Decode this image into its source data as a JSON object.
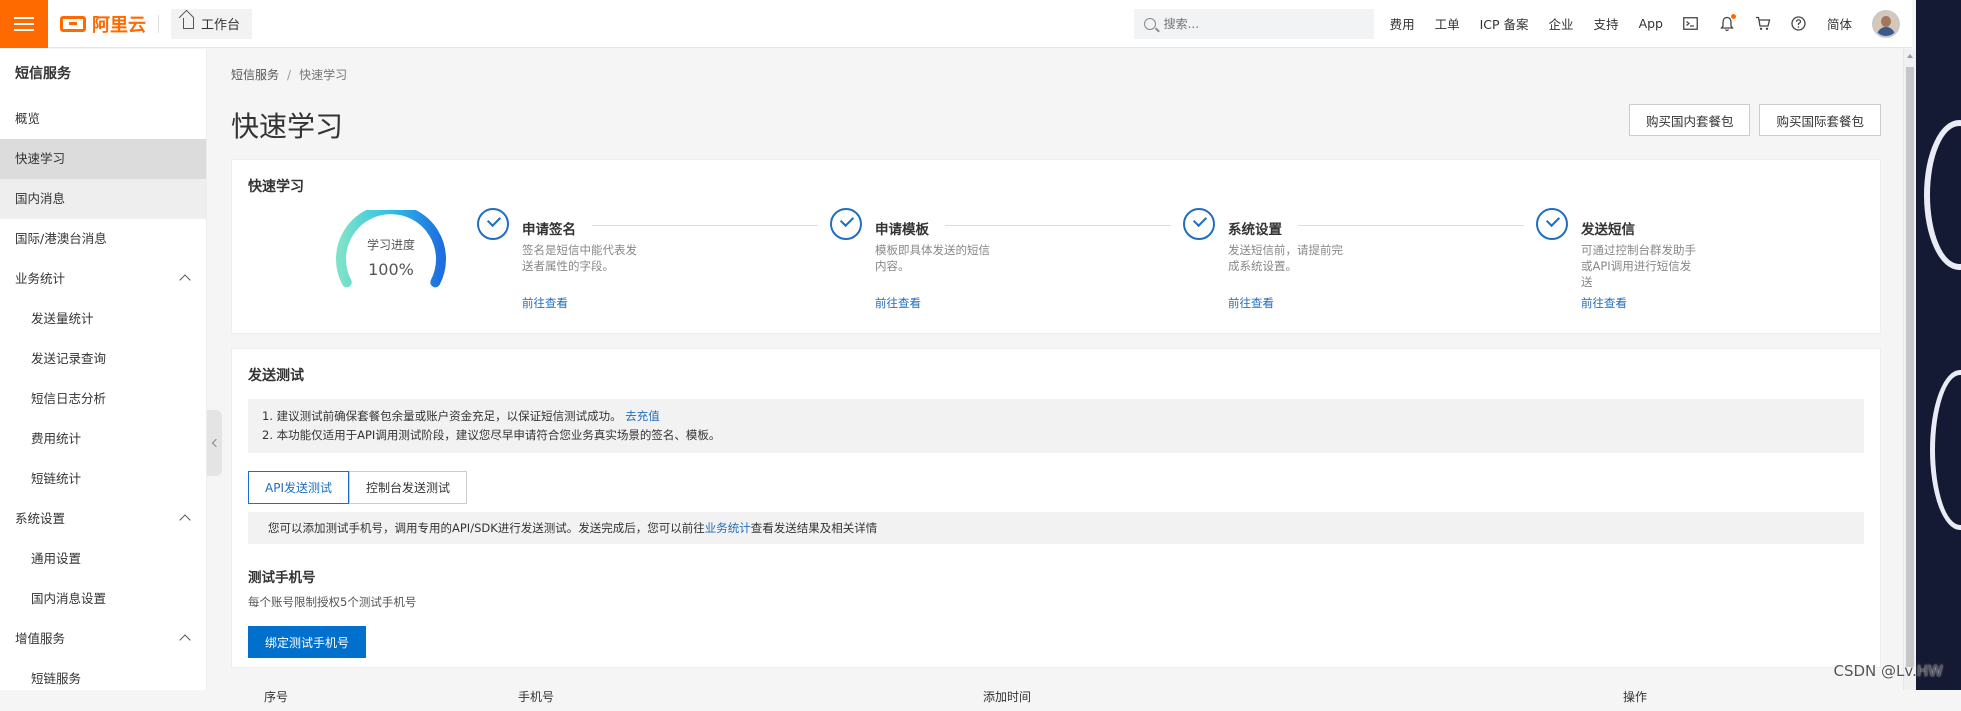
{
  "topbar": {
    "logo_text": "阿里云",
    "workbench_label": "工作台",
    "search_placeholder": "搜索...",
    "nav": [
      "费用",
      "工单",
      "ICP 备案",
      "企业",
      "支持",
      "App"
    ],
    "lang": "简体",
    "icons": [
      "terminal-icon",
      "bell-icon",
      "cart-icon",
      "help-icon"
    ],
    "accent_color": "#ff6a00"
  },
  "sidebar": {
    "title": "短信服务",
    "items": [
      {
        "label": "概览",
        "level": 0,
        "state": ""
      },
      {
        "label": "快速学习",
        "level": 0,
        "state": "active"
      },
      {
        "label": "国内消息",
        "level": 0,
        "state": "grey"
      },
      {
        "label": "国际/港澳台消息",
        "level": 0,
        "state": ""
      },
      {
        "label": "业务统计",
        "level": 0,
        "state": "",
        "expanded": true
      },
      {
        "label": "发送量统计",
        "level": 1,
        "state": ""
      },
      {
        "label": "发送记录查询",
        "level": 1,
        "state": ""
      },
      {
        "label": "短信日志分析",
        "level": 1,
        "state": ""
      },
      {
        "label": "费用统计",
        "level": 1,
        "state": ""
      },
      {
        "label": "短链统计",
        "level": 1,
        "state": ""
      },
      {
        "label": "系统设置",
        "level": 0,
        "state": "",
        "expanded": true
      },
      {
        "label": "通用设置",
        "level": 1,
        "state": ""
      },
      {
        "label": "国内消息设置",
        "level": 1,
        "state": ""
      },
      {
        "label": "增值服务",
        "level": 0,
        "state": "",
        "expanded": true
      },
      {
        "label": "短链服务",
        "level": 1,
        "state": ""
      }
    ]
  },
  "breadcrumb": {
    "root": "短信服务",
    "sep": "/",
    "current": "快速学习"
  },
  "page": {
    "title": "快速学习",
    "buy_domestic": "购买国内套餐包",
    "buy_international": "购买国际套餐包"
  },
  "quick": {
    "title": "快速学习",
    "progress_label": "学习进度",
    "progress_text": "100%",
    "progress_value": 1.0,
    "steps": [
      {
        "title": "申请签名",
        "desc": "签名是短信中能代表发送者属性的字段。",
        "link": "前往查看"
      },
      {
        "title": "申请模板",
        "desc": "模板即具体发送的短信内容。",
        "link": "前往查看"
      },
      {
        "title": "系统设置",
        "desc": "发送短信前，请提前完成系统设置。",
        "link": "前往查看"
      },
      {
        "title": "发送短信",
        "desc": "可通过控制台群发助手或API调用进行短信发送",
        "link": "前往查看"
      }
    ]
  },
  "test": {
    "title": "发送测试",
    "notice_1": "1. 建议测试前确保套餐包余量或账户资金充足，以保证短信测试成功。",
    "notice_1_link": "去充值",
    "notice_2": "2. 本功能仅适用于API调用测试阶段，建议您尽早申请符合您业务真实场景的签名、模板。",
    "tabs": [
      "API发送测试",
      "控制台发送测试"
    ],
    "tip_before": "您可以添加测试手机号，调用专用的API/SDK进行发送测试。发送完成后，您可以前往",
    "tip_link": "业务统计",
    "tip_after": "查看发送结果及相关详情",
    "phones_title": "测试手机号",
    "phones_desc": "每个账号限制授权5个测试手机号",
    "bind_button": "绑定测试手机号",
    "columns": [
      "序号",
      "手机号",
      "添加时间",
      "操作"
    ]
  },
  "watermark": "CSDN @Lv.HW"
}
